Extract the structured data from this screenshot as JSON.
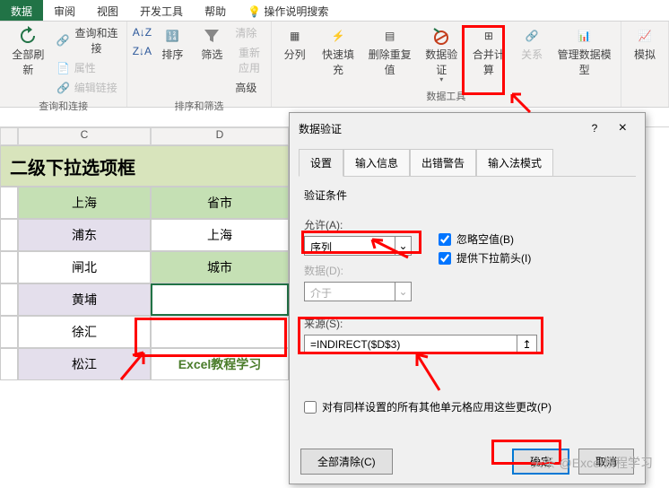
{
  "tabs": {
    "data": "数据",
    "review": "审阅",
    "view": "视图",
    "developer": "开发工具",
    "help": "帮助",
    "tellme": "操作说明搜索"
  },
  "ribbon": {
    "refresh": "全部刷新",
    "queries": "查询和连接",
    "props": "属性",
    "links": "编辑链接",
    "group1": "查询和连接",
    "sortAZ": "",
    "sortZA": "",
    "sort": "排序",
    "filter": "筛选",
    "clear": "清除",
    "reapply": "重新应用",
    "advanced": "高级",
    "group2": "排序和筛选",
    "texttocol": "分列",
    "flashfill": "快速填充",
    "removedup": "删除重复值",
    "datavalid": "数据验证",
    "consolidate": "合并计算",
    "relations": "关系",
    "datamodel": "管理数据模型",
    "group3": "数据工具",
    "forecast": "模拟"
  },
  "sheet": {
    "colC": "C",
    "colD": "D",
    "title": "二级下拉选项框",
    "rows": [
      {
        "c": "上海",
        "d": "省市"
      },
      {
        "c": "浦东",
        "d": "上海"
      },
      {
        "c": "闸北",
        "d": "城市"
      },
      {
        "c": "黄埔",
        "d": ""
      },
      {
        "c": "徐汇",
        "d": ""
      },
      {
        "c": "松江",
        "d": ""
      }
    ],
    "brand": "Excel教程学习"
  },
  "dialog": {
    "title": "数据验证",
    "tabs": {
      "settings": "设置",
      "input": "输入信息",
      "error": "出错警告",
      "ime": "输入法模式"
    },
    "section": "验证条件",
    "allow_lbl": "允许(A):",
    "allow_val": "序列",
    "data_lbl": "数据(D):",
    "data_val": "介于",
    "source_lbl": "来源(S):",
    "source_val": "=INDIRECT($D$3)",
    "ignore": "忽略空值(B)",
    "dropdown": "提供下拉箭头(I)",
    "applyall": "对有同样设置的所有其他单元格应用这些更改(P)",
    "clearall": "全部清除(C)",
    "ok": "确定",
    "cancel": "取消",
    "help": "?",
    "close": "×"
  },
  "watermark": "头条 @Excel教程学习"
}
